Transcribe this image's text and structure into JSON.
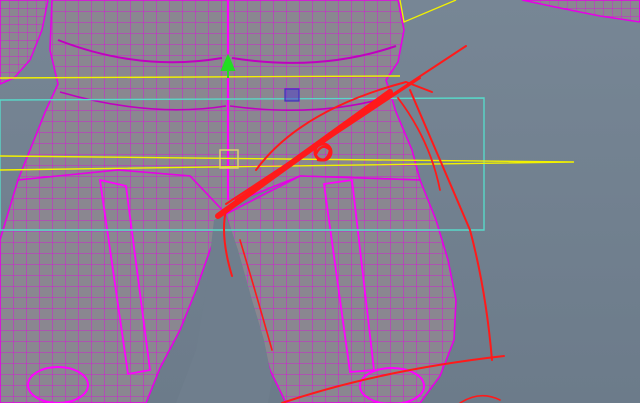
{
  "viewport": {
    "background_color": "#71808f",
    "mesh_surface_color": "#8a8790",
    "wireframe_color": "#e600e6",
    "control_yellow_color": "#f2f200",
    "control_cyan_color": "#58d8c8",
    "annotation_red_color": "#ff1a1a",
    "move_handle_color": "#22dd22",
    "selection_marker_color": "#5040c8",
    "pivot_marker_color": "#e0d070"
  },
  "scene": {
    "objects": [
      "character-mesh-torso",
      "character-mesh-left-leg",
      "character-mesh-right-leg",
      "character-mesh-left-arm",
      "character-mesh-right-arm",
      "yellow-ground-plane",
      "cyan-bounding-box",
      "red-annotation-strokes",
      "move-manipulator",
      "selected-vertex-marker",
      "pivot-marker"
    ]
  }
}
